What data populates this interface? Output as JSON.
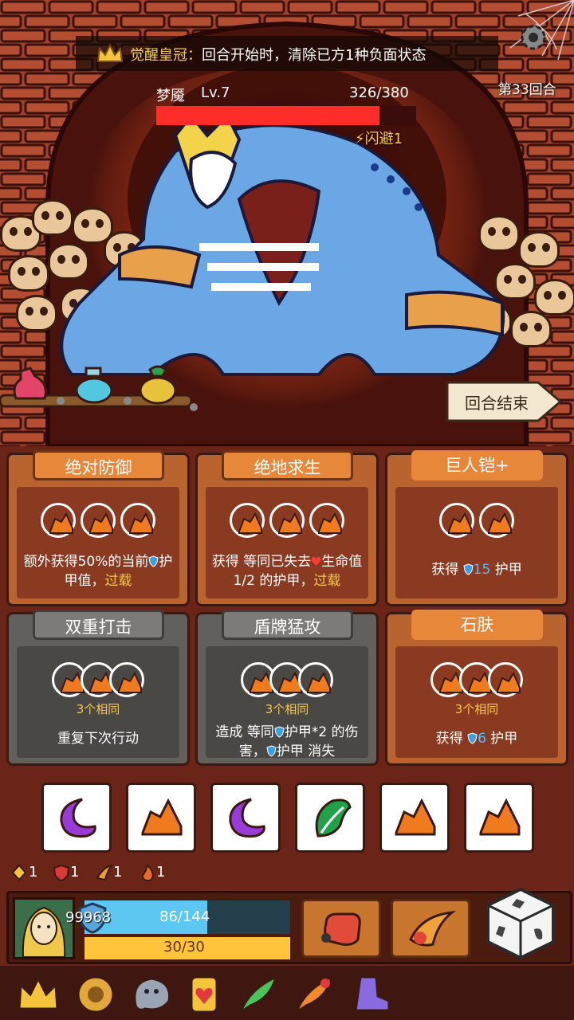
{
  "banner": {
    "relic_name": "觉醒皇冠：",
    "relic_desc": "回合开始时，清除已方1种负面状态"
  },
  "round": "第33回合",
  "enemy": {
    "name": "梦魇",
    "level": "Lv.7",
    "hp_text": "326/380",
    "hp": 326,
    "hp_max": 380,
    "dodge": "闪避1"
  },
  "end_turn_label": "回合结束",
  "cards": [
    {
      "title": "绝对防御",
      "style": "orange",
      "slots": 3,
      "same": "",
      "desc_a": "额外获得50%的当前",
      "desc_b": "护甲值，",
      "desc_c": "过载"
    },
    {
      "title": "绝地求生",
      "style": "orange",
      "slots": 3,
      "same": "",
      "desc_a": "获得 等同已失去",
      "desc_b": "生命值1/2 的护甲，",
      "desc_c": "过载"
    },
    {
      "title": "巨人铠+",
      "style": "brown",
      "slots": 2,
      "same": "",
      "desc_a": "获得 ",
      "desc_b": "15",
      "desc_c": " 护甲"
    },
    {
      "title": "双重打击",
      "style": "gray",
      "slots": 3,
      "same": "3个相同",
      "desc_a": "重复下次行动",
      "desc_b": "",
      "desc_c": ""
    },
    {
      "title": "盾牌猛攻",
      "style": "gray",
      "slots": 3,
      "same": "3个相同",
      "desc_a": "造成 等同",
      "desc_b": "护甲*2 的伤害，",
      "desc_c": "护甲 消失"
    },
    {
      "title": "石肤",
      "style": "brown",
      "slots": 3,
      "same": "3个相同",
      "desc_a": "获得 ",
      "desc_b": "6",
      "desc_c": " 护甲"
    }
  ],
  "dice": [
    {
      "face": "moon",
      "color": "#9a3ad8"
    },
    {
      "face": "rock",
      "color": "#f07a1e"
    },
    {
      "face": "moon",
      "color": "#9a3ad8"
    },
    {
      "face": "leaf",
      "color": "#1fa24a"
    },
    {
      "face": "rock",
      "color": "#f07a1e"
    },
    {
      "face": "rock",
      "color": "#f07a1e"
    }
  ],
  "statuses": [
    {
      "icon": "rank-icon",
      "value": "1"
    },
    {
      "icon": "heart-shield-icon",
      "value": "1"
    },
    {
      "icon": "claw-icon",
      "value": "1"
    },
    {
      "icon": "flame-icon",
      "value": "1"
    }
  ],
  "hero": {
    "armor": "99968",
    "hp_text": "86/144",
    "hp": 86,
    "hp_max": 144,
    "energy_text": "30/30",
    "energy": 30,
    "energy_max": 30
  },
  "relics": [
    "crown-icon",
    "compass-icon",
    "ghost-icon",
    "heart-card-icon",
    "feather-icon",
    "fire-feather-icon",
    "boot-icon"
  ]
}
